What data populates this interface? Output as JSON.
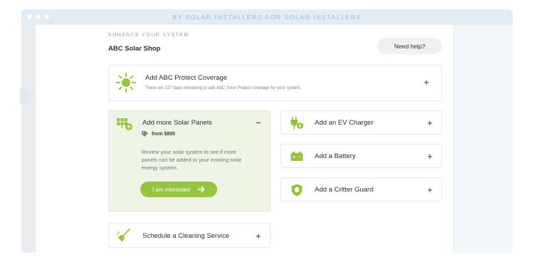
{
  "window": {
    "title": "BY SOLAR INSTALLERS FOR SOLAR INSTALLERS"
  },
  "header": {
    "eyebrow": "ENHANCE YOUR SYSTEM",
    "shop_name": "ABC Solar Shop",
    "help_label": "Need help?"
  },
  "protect": {
    "title": "Add ABC Protect Coverage",
    "subtitle": "There are 127 days remaining to add ABC Solar Protect coverage for your system.",
    "toggle": "+"
  },
  "panels": {
    "title": "Add more Solar Panels",
    "toggle": "−",
    "price": "from $895",
    "description": "Review your solar system to see if more panels can be added to your existing solar energy system.",
    "cta_label": "I am interested"
  },
  "ev": {
    "title": "Add an EV Charger",
    "toggle": "+"
  },
  "battery": {
    "title": "Add a Battery",
    "toggle": "+"
  },
  "critter": {
    "title": "Add a Critter Guard",
    "toggle": "+"
  },
  "cleaning": {
    "title": "Schedule a Cleaning Service",
    "toggle": "+"
  },
  "colors": {
    "accent": "#96c43f",
    "panel_bg": "#eef5e6",
    "text": "#2b2f33"
  },
  "icons": {
    "sun": "sun-icon",
    "solar_panel": "solar-panel-add-icon",
    "tag": "price-tag-icon",
    "arrow": "arrow-right-icon",
    "ev": "ev-plug-icon",
    "battery": "battery-icon",
    "shield": "shield-icon",
    "broom": "broom-icon"
  }
}
